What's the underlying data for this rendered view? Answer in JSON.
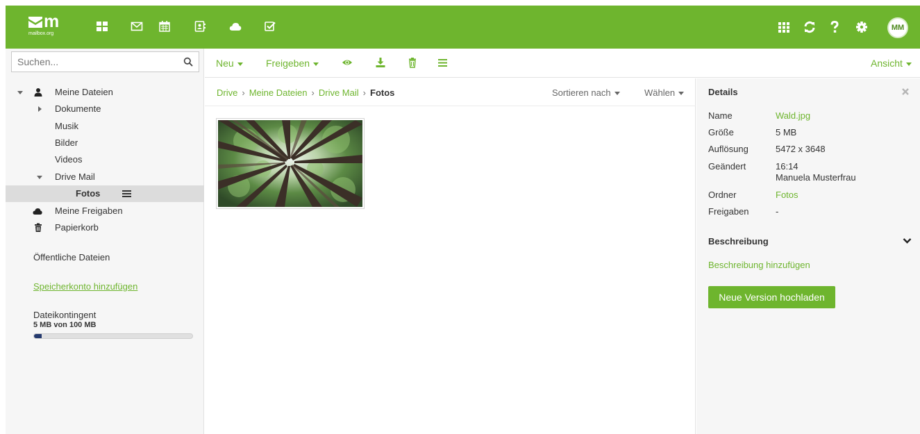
{
  "brand": {
    "logo_mark": "m",
    "logo_sub": "mailbox.org"
  },
  "topbar": {
    "apps": [
      "portal-icon",
      "mail-icon",
      "calendar-icon",
      "contacts-icon",
      "drive-icon",
      "tasks-icon"
    ],
    "right_icons": [
      "app-launcher-icon",
      "refresh-icon",
      "help-icon",
      "settings-icon"
    ],
    "avatar_initials": "MM"
  },
  "search": {
    "placeholder": "Suchen..."
  },
  "sidebar": {
    "my_files": "Meine Dateien",
    "folders": [
      "Dokumente",
      "Musik",
      "Bilder",
      "Videos"
    ],
    "drive_mail": "Drive Mail",
    "current_folder": "Fotos",
    "my_shares": "Meine Freigaben",
    "trash": "Papierkorb",
    "public_files": "Öffentliche Dateien",
    "add_storage": "Speicherkonto hinzufügen",
    "quota_title": "Dateikontingent",
    "quota_value": "5 MB von 100 MB",
    "quota_fraction": 0.05
  },
  "toolbar": {
    "new_label": "Neu",
    "share_label": "Freigeben",
    "view_label": "Ansicht"
  },
  "breadcrumb": [
    "Drive",
    "Meine Dateien",
    "Drive Mail"
  ],
  "breadcrumb_current": "Fotos",
  "listing": {
    "sort_label": "Sortieren nach",
    "select_label": "Wählen"
  },
  "details": {
    "title": "Details",
    "name_label": "Name",
    "name_value": "Wald.jpg",
    "size_label": "Größe",
    "size_value": "5 MB",
    "resolution_label": "Auflösung",
    "resolution_value": "5472 x 3648",
    "modified_label": "Geändert",
    "modified_time": "16:14",
    "modified_by": "Manuela Musterfrau",
    "folder_label": "Ordner",
    "folder_value": "Fotos",
    "shares_label": "Freigaben",
    "shares_value": "-",
    "description_title": "Beschreibung",
    "add_description": "Beschreibung hinzufügen",
    "upload_button": "Neue Version hochladen"
  },
  "colors": {
    "accent": "#6eb52e",
    "quota_fill": "#253a6e",
    "panel_bg": "#f6f6f6"
  }
}
